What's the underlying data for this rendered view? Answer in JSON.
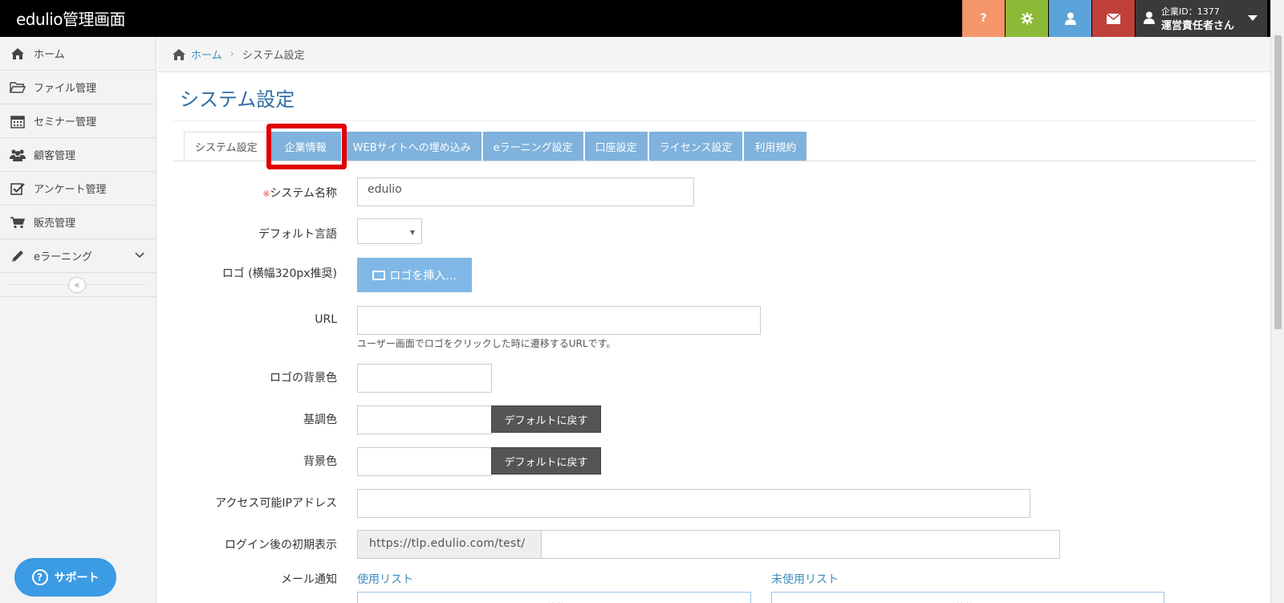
{
  "app": {
    "title": "edulio管理画面"
  },
  "topbar": {
    "help_label": "?",
    "account_line1": "企業ID：1377",
    "account_line2": "運営責任者さん"
  },
  "sidebar": {
    "items": [
      {
        "label": "ホーム",
        "icon": "home-icon"
      },
      {
        "label": "ファイル管理",
        "icon": "folder-icon"
      },
      {
        "label": "セミナー管理",
        "icon": "calendar-icon"
      },
      {
        "label": "顧客管理",
        "icon": "users-icon"
      },
      {
        "label": "アンケート管理",
        "icon": "checkbox-icon"
      },
      {
        "label": "販売管理",
        "icon": "cart-icon"
      },
      {
        "label": "eラーニング",
        "icon": "pencil-icon"
      }
    ],
    "collapse_symbol": "«",
    "support_label": "サポート"
  },
  "breadcrumb": {
    "home": "ホーム",
    "current": "システム設定"
  },
  "page": {
    "title": "システム設定"
  },
  "tabs": [
    {
      "label": "システム設定",
      "active": true
    },
    {
      "label": "企業情報",
      "active": false
    },
    {
      "label": "WEBサイトへの埋め込み",
      "active": false
    },
    {
      "label": "eラーニング設定",
      "active": false
    },
    {
      "label": "口座設定",
      "active": false
    },
    {
      "label": "ライセンス設定",
      "active": false
    },
    {
      "label": "利用規約",
      "active": false
    }
  ],
  "form": {
    "required_mark": "※",
    "system_name_label": "システム名称",
    "system_name_value": "edulio",
    "default_language_label": "デフォルト言語",
    "logo_label": "ロゴ (横幅320px推奨)",
    "logo_button": "ロゴを挿入...",
    "url_label": "URL",
    "url_help": "ユーザー画面でロゴをクリックした時に遷移するURLです。",
    "logo_bg_label": "ロゴの背景色",
    "base_color_label": "基調色",
    "bg_color_label": "背景色",
    "reset_default": "デフォルトに戻す",
    "ip_label": "アクセス可能IPアドレス",
    "initial_view_label": "ログイン後の初期表示",
    "initial_view_prefix": "https://tlp.edulio.com/test/",
    "mail_label": "メール通知",
    "used_list": "使用リスト",
    "unused_list": "未使用リスト"
  },
  "colors": {
    "accent": "#2f6ca3",
    "tab": "#7fb2dc",
    "highlight": "#e00000",
    "help_btn": "#f4956a",
    "settings_btn": "#8cba36",
    "user_btn": "#5ba3d8",
    "mail_btn": "#c0413a"
  }
}
